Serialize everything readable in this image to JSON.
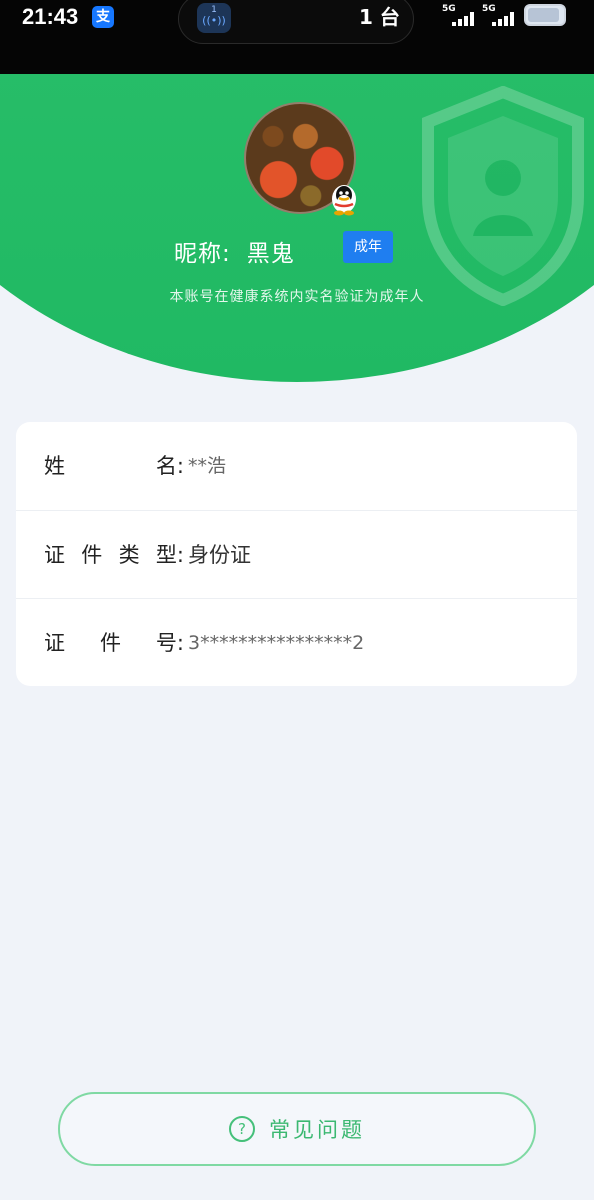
{
  "status_bar": {
    "time": "21:43",
    "alipay_icon": "支",
    "hotspot_count": "1",
    "hotspot_glyph": "((•))",
    "connected_devices": "1 台",
    "signal_1_label": "5G",
    "signal_2_label": "5G",
    "battery_level": 0.9
  },
  "profile": {
    "nickname_label": "昵称:",
    "nickname": "黑鬼",
    "badge": "成年",
    "verify_note": "本账号在健康系统内实名验证为成年人"
  },
  "info": {
    "rows": [
      {
        "label": [
          "姓",
          "名:"
        ],
        "value": "**浩"
      },
      {
        "label": [
          "证",
          "件",
          "类",
          "型:"
        ],
        "value": "身份证"
      },
      {
        "label": [
          "证",
          "件",
          "号:"
        ],
        "value": "3****************2"
      }
    ]
  },
  "faq": {
    "icon": "?",
    "label": "常见问题"
  },
  "colors": {
    "brand_green": "#22bb66",
    "adult_badge": "#1f7ef0",
    "page_bg": "#f0f3f9"
  }
}
